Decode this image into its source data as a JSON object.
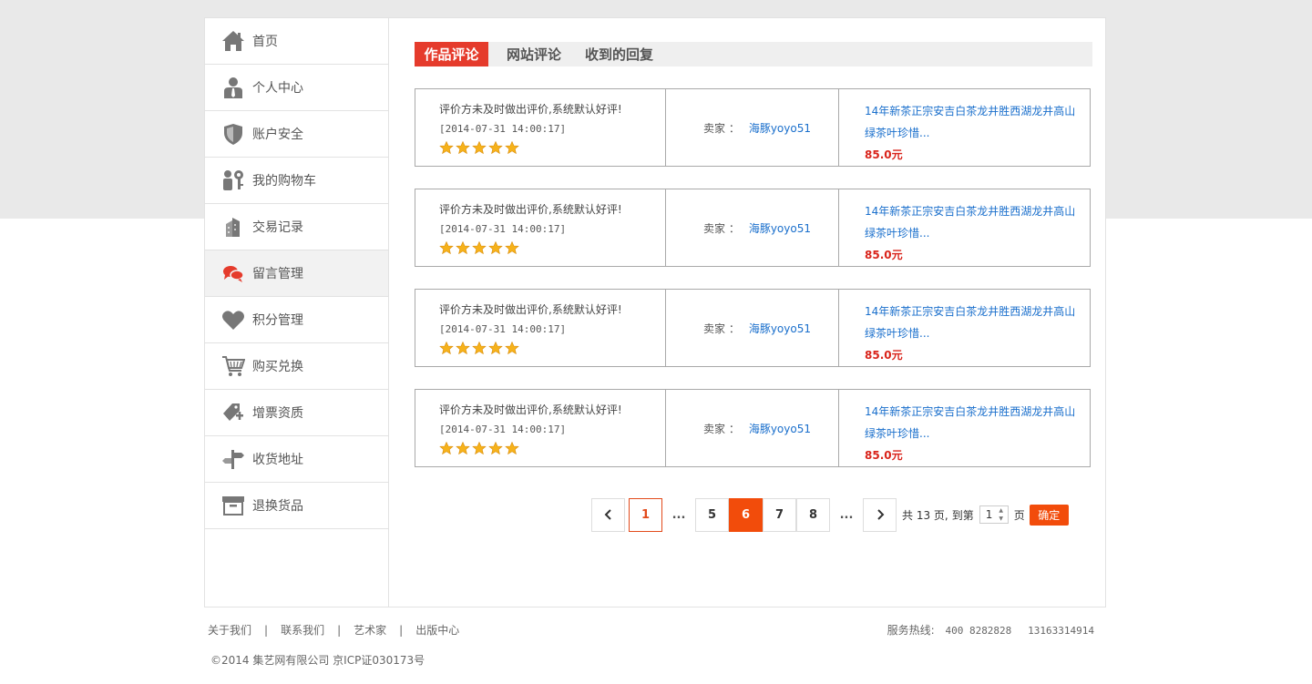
{
  "sidebar": {
    "items": [
      {
        "label": "首页",
        "icon": "home-icon"
      },
      {
        "label": "个人中心",
        "icon": "user-icon"
      },
      {
        "label": "账户安全",
        "icon": "shield-icon"
      },
      {
        "label": "我的购物车",
        "icon": "people-key-icon"
      },
      {
        "label": "交易记录",
        "icon": "buildings-icon"
      },
      {
        "label": "留言管理",
        "icon": "chat-bubbles-icon",
        "active": true
      },
      {
        "label": "积分管理",
        "icon": "heart-icon"
      },
      {
        "label": "购买兑换",
        "icon": "cart-icon"
      },
      {
        "label": "增票资质",
        "icon": "tag-plus-icon"
      },
      {
        "label": "收货地址",
        "icon": "signpost-icon"
      },
      {
        "label": "退换货品",
        "icon": "box-icon"
      }
    ]
  },
  "tabs": [
    {
      "label": "作品评论",
      "active": true
    },
    {
      "label": "网站评论"
    },
    {
      "label": "收到的回复"
    }
  ],
  "reviews": [
    {
      "text": "评价方未及时做出评价,系统默认好评!",
      "date": "[2014-07-31 14:00:17]",
      "stars": 5,
      "seller_label": "卖家 ：",
      "seller": "海豚yoyo51",
      "product_line1": "14年新茶正宗安吉白茶龙井胜西湖龙井高山",
      "product_line2": "绿茶叶珍惜...",
      "price": "85.0元"
    },
    {
      "text": "评价方未及时做出评价,系统默认好评!",
      "date": "[2014-07-31 14:00:17]",
      "stars": 5,
      "seller_label": "卖家 ：",
      "seller": "海豚yoyo51",
      "product_line1": "14年新茶正宗安吉白茶龙井胜西湖龙井高山",
      "product_line2": "绿茶叶珍惜...",
      "price": "85.0元"
    },
    {
      "text": "评价方未及时做出评价,系统默认好评!",
      "date": "[2014-07-31 14:00:17]",
      "stars": 5,
      "seller_label": "卖家 ：",
      "seller": "海豚yoyo51",
      "product_line1": "14年新茶正宗安吉白茶龙井胜西湖龙井高山",
      "product_line2": "绿茶叶珍惜...",
      "price": "85.0元"
    },
    {
      "text": "评价方未及时做出评价,系统默认好评!",
      "date": "[2014-07-31 14:00:17]",
      "stars": 5,
      "seller_label": "卖家 ：",
      "seller": "海豚yoyo51",
      "product_line1": "14年新茶正宗安吉白茶龙井胜西湖龙井高山",
      "product_line2": "绿茶叶珍惜...",
      "price": "85.0元"
    }
  ],
  "pager": {
    "prev_icon": "chevron-left-icon",
    "next_icon": "chevron-right-icon",
    "page_outlined": "1",
    "ellipsis": "...",
    "page_5": "5",
    "page_6": "6",
    "page_7": "7",
    "page_8": "8",
    "total_text": "共 13 页,",
    "goto_text": "到第",
    "goto_value": "1",
    "page_suffix": "页",
    "confirm_label": "确定"
  },
  "footer": {
    "links": [
      "关于我们",
      "联系我们",
      "艺术家",
      "出版中心"
    ],
    "separator": "|",
    "hotline_label": "服务热线:",
    "hotline_1": "400 8282828",
    "hotline_2": "13163314914",
    "copyright": "©2014 集艺网有限公司   京ICP证030173号"
  },
  "colors": {
    "accent": "#f24c0b",
    "tab_active": "#e53b2c",
    "link": "#1a6fcc",
    "price": "#d9241b",
    "star": "#f6b21b"
  }
}
